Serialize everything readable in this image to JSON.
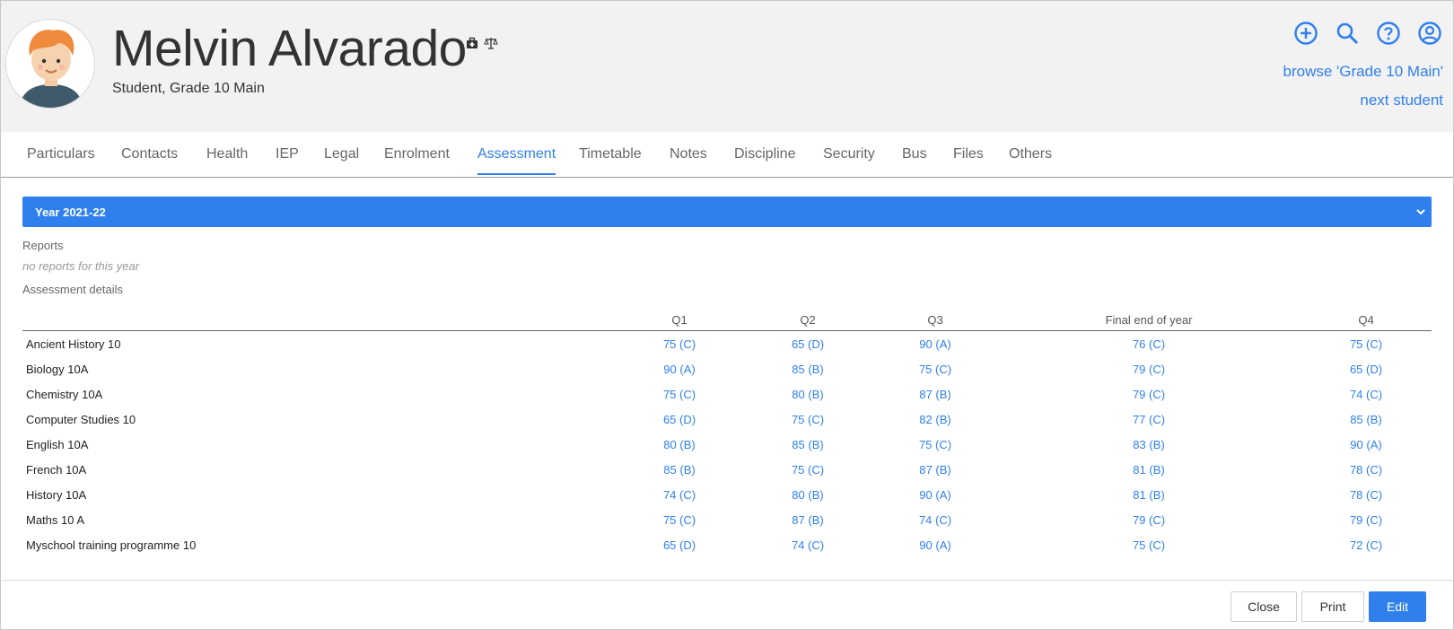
{
  "header": {
    "name": "Melvin Alvarado",
    "subtitle": "Student, Grade 10 Main",
    "browse_link": "browse 'Grade 10 Main'",
    "next_link": "next student",
    "icons": [
      "add-circle-icon",
      "search-icon",
      "help-icon",
      "account-icon"
    ],
    "name_icons": [
      "medical-kit-icon",
      "legal-scale-icon"
    ]
  },
  "tabs": [
    {
      "label": "Particulars"
    },
    {
      "label": "Contacts"
    },
    {
      "label": "Health"
    },
    {
      "label": "IEP"
    },
    {
      "label": "Legal"
    },
    {
      "label": "Enrolment"
    },
    {
      "label": "Assessment",
      "active": true
    },
    {
      "label": "Timetable"
    },
    {
      "label": "Notes"
    },
    {
      "label": "Discipline"
    },
    {
      "label": "Security"
    },
    {
      "label": "Bus"
    },
    {
      "label": "Files"
    },
    {
      "label": "Others"
    }
  ],
  "year_selector": {
    "label": "Year 2021-22"
  },
  "reports": {
    "label": "Reports",
    "empty": "no reports for this year"
  },
  "assessment": {
    "label": "Assessment details",
    "columns": [
      "Q1",
      "Q2",
      "Q3",
      "Final end of year",
      "Q4"
    ],
    "rows": [
      {
        "subject": "Ancient History 10",
        "grades": [
          "75 (C)",
          "65 (D)",
          "90 (A)",
          "76 (C)",
          "75 (C)"
        ]
      },
      {
        "subject": "Biology 10A",
        "grades": [
          "90 (A)",
          "85 (B)",
          "75 (C)",
          "79 (C)",
          "65 (D)"
        ]
      },
      {
        "subject": "Chemistry 10A",
        "grades": [
          "75 (C)",
          "80 (B)",
          "87 (B)",
          "79 (C)",
          "74 (C)"
        ]
      },
      {
        "subject": "Computer Studies 10",
        "grades": [
          "65 (D)",
          "75 (C)",
          "82 (B)",
          "77 (C)",
          "85 (B)"
        ]
      },
      {
        "subject": "English 10A",
        "grades": [
          "80 (B)",
          "85 (B)",
          "75 (C)",
          "83 (B)",
          "90 (A)"
        ]
      },
      {
        "subject": "French 10A",
        "grades": [
          "85 (B)",
          "75 (C)",
          "87 (B)",
          "81 (B)",
          "78 (C)"
        ]
      },
      {
        "subject": "History 10A",
        "grades": [
          "74 (C)",
          "80 (B)",
          "90 (A)",
          "81 (B)",
          "78 (C)"
        ]
      },
      {
        "subject": "Maths 10 A",
        "grades": [
          "75 (C)",
          "87 (B)",
          "74 (C)",
          "79 (C)",
          "79 (C)"
        ]
      },
      {
        "subject": "Myschool training programme 10",
        "grades": [
          "65 (D)",
          "74 (C)",
          "90 (A)",
          "75 (C)",
          "72 (C)"
        ]
      }
    ]
  },
  "footer": {
    "close": "Close",
    "print": "Print",
    "edit": "Edit"
  },
  "colors": {
    "accent": "#2f80ed",
    "header_bg": "#f2f2f2"
  }
}
